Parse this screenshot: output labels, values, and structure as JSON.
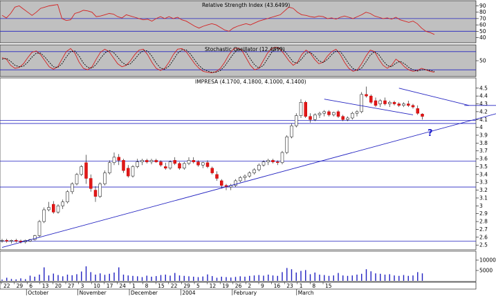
{
  "chart_data": [
    {
      "type": "line",
      "title": "Relative Strength Index (43.6499)",
      "y_ticks": [
        40,
        50,
        60,
        70,
        80,
        90
      ],
      "ylim": [
        33,
        97
      ],
      "reference_lines": [
        70,
        50
      ],
      "series": [
        {
          "color": "#d42020",
          "values": [
            75,
            71,
            78,
            88,
            90,
            85,
            80,
            75,
            80,
            86,
            88,
            90,
            91,
            92,
            70,
            67,
            68,
            78,
            80,
            83,
            82,
            80,
            73,
            74,
            76,
            78,
            77,
            73,
            71,
            76,
            74,
            72,
            70,
            68,
            69,
            66,
            70,
            73,
            70,
            73,
            70,
            72,
            68,
            66,
            62,
            58,
            55,
            58,
            60,
            62,
            60,
            56,
            52,
            50,
            55,
            58,
            60,
            62,
            60,
            63,
            66,
            68,
            70,
            72,
            74,
            76,
            82,
            88,
            86,
            80,
            76,
            75,
            73,
            72,
            74,
            73,
            70,
            71,
            69,
            72,
            74,
            72,
            70,
            73,
            76,
            80,
            78,
            74,
            72,
            70,
            71,
            69,
            72,
            68,
            66,
            64,
            66,
            62,
            55,
            50,
            48,
            45
          ]
        }
      ]
    },
    {
      "type": "line",
      "title": "Stochastic Oscillator (12.4899)",
      "y_ticks": [
        50
      ],
      "ylim": [
        0,
        100
      ],
      "reference_lines": [
        80,
        20
      ],
      "series": [
        {
          "color": "#d42020",
          "values": [
            60,
            55,
            35,
            25,
            28,
            40,
            60,
            78,
            82,
            70,
            50,
            30,
            22,
            30,
            55,
            80,
            90,
            75,
            45,
            25,
            20,
            30,
            55,
            78,
            88,
            80,
            60,
            40,
            30,
            35,
            50,
            70,
            85,
            88,
            70,
            45,
            25,
            18,
            25,
            45,
            70,
            88,
            90,
            80,
            60,
            40,
            25,
            15,
            12,
            10,
            14,
            25,
            45,
            70,
            88,
            92,
            85,
            60,
            35,
            20,
            25,
            50,
            75,
            90,
            95,
            88,
            70,
            50,
            35,
            45,
            70,
            85,
            75,
            55,
            40,
            45,
            65,
            80,
            88,
            70,
            45,
            25,
            15,
            20,
            40,
            65,
            85,
            80,
            55,
            35,
            25,
            35,
            55,
            45,
            30,
            20,
            15,
            18,
            25,
            20,
            15,
            12
          ]
        },
        {
          "color": "#000000",
          "values": [
            55,
            58,
            48,
            35,
            30,
            32,
            45,
            62,
            75,
            75,
            62,
            45,
            30,
            28,
            40,
            62,
            80,
            82,
            65,
            42,
            28,
            26,
            38,
            58,
            75,
            84,
            78,
            62,
            45,
            36,
            40,
            55,
            72,
            84,
            82,
            65,
            42,
            26,
            22,
            32,
            52,
            74,
            86,
            86,
            72,
            52,
            34,
            22,
            16,
            12,
            12,
            18,
            32,
            52,
            72,
            86,
            88,
            78,
            56,
            36,
            26,
            34,
            56,
            78,
            90,
            92,
            82,
            64,
            46,
            42,
            56,
            74,
            78,
            66,
            50,
            44,
            54,
            70,
            82,
            80,
            62,
            40,
            24,
            18,
            26,
            46,
            68,
            80,
            70,
            50,
            34,
            30,
            42,
            48,
            40,
            28,
            20,
            16,
            20,
            21,
            18,
            15
          ]
        }
      ]
    },
    {
      "type": "candlestick",
      "title": "IMPRESA (4.1700, 4.1800, 4.1000, 4.1400)",
      "ylim": [
        2.44,
        4.63
      ],
      "y_ticks": [
        2.5,
        2.6,
        2.7,
        2.8,
        2.9,
        3.0,
        3.1,
        3.2,
        3.3,
        3.4,
        3.5,
        3.6,
        3.7,
        3.8,
        3.9,
        4.0,
        4.1,
        4.2,
        4.3,
        4.4,
        4.5
      ],
      "x_tick_labels": [
        "22",
        "29",
        "6",
        "13",
        "20",
        "27",
        "3",
        "10",
        "17",
        "24",
        "1",
        "8",
        "15",
        "22",
        "29",
        "5",
        "12",
        "19",
        "26",
        "2",
        "9",
        "16",
        "23",
        "1",
        "8",
        "15"
      ],
      "month_labels": [
        "October",
        "November",
        "December",
        "2004",
        "February",
        "March"
      ],
      "annotation": "?",
      "horizontal_levels": [
        4.09,
        4.05,
        3.57,
        3.24,
        2.55
      ],
      "trend_lines": [
        {
          "from": [
            0,
            2.47
          ],
          "to": [
            108,
            4.21
          ],
          "color": "#2020c0"
        },
        {
          "from": [
            69,
            4.36
          ],
          "to": [
            88,
            4.16
          ],
          "color": "#2020c0"
        },
        {
          "from": [
            85,
            4.5
          ],
          "to": [
            100,
            4.28
          ],
          "color": "#2020c0"
        },
        {
          "from": [
            99,
            4.28
          ],
          "to": [
            106,
            4.28
          ],
          "color": "#2020c0"
        }
      ],
      "candles": [
        [
          2.56,
          2.58,
          2.53,
          2.56
        ],
        [
          2.56,
          2.58,
          2.53,
          2.55
        ],
        [
          2.55,
          2.57,
          2.52,
          2.56
        ],
        [
          2.56,
          2.58,
          2.53,
          2.55
        ],
        [
          2.55,
          2.57,
          2.52,
          2.54
        ],
        [
          2.54,
          2.57,
          2.52,
          2.56
        ],
        [
          2.55,
          2.58,
          2.54,
          2.57
        ],
        [
          2.57,
          2.63,
          2.56,
          2.62
        ],
        [
          2.62,
          2.82,
          2.6,
          2.8
        ],
        [
          2.8,
          2.98,
          2.78,
          2.95
        ],
        [
          2.95,
          3.05,
          2.93,
          2.98
        ],
        [
          3.02,
          3.06,
          2.9,
          2.92
        ],
        [
          2.92,
          3.02,
          2.9,
          3.0
        ],
        [
          3.0,
          3.08,
          2.96,
          3.05
        ],
        [
          3.05,
          3.2,
          3.03,
          3.18
        ],
        [
          3.18,
          3.3,
          3.15,
          3.28
        ],
        [
          3.28,
          3.42,
          3.26,
          3.4
        ],
        [
          3.4,
          3.52,
          3.38,
          3.5
        ],
        [
          3.55,
          3.65,
          3.28,
          3.35
        ],
        [
          3.35,
          3.4,
          3.18,
          3.22
        ],
        [
          3.2,
          3.25,
          3.05,
          3.12
        ],
        [
          3.12,
          3.3,
          3.1,
          3.28
        ],
        [
          3.28,
          3.45,
          3.26,
          3.42
        ],
        [
          3.42,
          3.58,
          3.4,
          3.55
        ],
        [
          3.55,
          3.68,
          3.52,
          3.62
        ],
        [
          3.62,
          3.66,
          3.52,
          3.58
        ],
        [
          3.58,
          3.6,
          3.42,
          3.45
        ],
        [
          3.48,
          3.52,
          3.36,
          3.38
        ],
        [
          3.38,
          3.52,
          3.36,
          3.5
        ],
        [
          3.5,
          3.6,
          3.48,
          3.56
        ],
        [
          3.56,
          3.6,
          3.52,
          3.58
        ],
        [
          3.58,
          3.6,
          3.54,
          3.56
        ],
        [
          3.56,
          3.6,
          3.53,
          3.58
        ],
        [
          3.58,
          3.6,
          3.55,
          3.56
        ],
        [
          3.56,
          3.58,
          3.5,
          3.52
        ],
        [
          3.5,
          3.55,
          3.46,
          3.48
        ],
        [
          3.48,
          3.58,
          3.46,
          3.56
        ],
        [
          3.58,
          3.62,
          3.52,
          3.54
        ],
        [
          3.54,
          3.56,
          3.46,
          3.48
        ],
        [
          3.48,
          3.56,
          3.46,
          3.54
        ],
        [
          3.54,
          3.62,
          3.52,
          3.58
        ],
        [
          3.58,
          3.62,
          3.54,
          3.56
        ],
        [
          3.56,
          3.58,
          3.5,
          3.52
        ],
        [
          3.52,
          3.56,
          3.48,
          3.55
        ],
        [
          3.55,
          3.58,
          3.48,
          3.5
        ],
        [
          3.48,
          3.5,
          3.4,
          3.42
        ],
        [
          3.4,
          3.44,
          3.32,
          3.35
        ],
        [
          3.32,
          3.34,
          3.22,
          3.26
        ],
        [
          3.26,
          3.28,
          3.2,
          3.24
        ],
        [
          3.24,
          3.28,
          3.2,
          3.26
        ],
        [
          3.26,
          3.34,
          3.24,
          3.32
        ],
        [
          3.32,
          3.38,
          3.3,
          3.36
        ],
        [
          3.36,
          3.4,
          3.32,
          3.38
        ],
        [
          3.38,
          3.44,
          3.36,
          3.42
        ],
        [
          3.42,
          3.48,
          3.4,
          3.46
        ],
        [
          3.46,
          3.54,
          3.44,
          3.52
        ],
        [
          3.52,
          3.58,
          3.5,
          3.56
        ],
        [
          3.56,
          3.6,
          3.52,
          3.58
        ],
        [
          3.58,
          3.6,
          3.54,
          3.56
        ],
        [
          3.56,
          3.58,
          3.52,
          3.55
        ],
        [
          3.55,
          3.7,
          3.53,
          3.68
        ],
        [
          3.68,
          3.9,
          3.66,
          3.88
        ],
        [
          3.88,
          4.05,
          3.86,
          4.02
        ],
        [
          4.02,
          4.18,
          4.0,
          4.15
        ],
        [
          4.15,
          4.36,
          4.12,
          4.32
        ],
        [
          4.32,
          4.34,
          4.12,
          4.14
        ],
        [
          4.14,
          4.18,
          4.06,
          4.1
        ],
        [
          4.1,
          4.18,
          4.08,
          4.16
        ],
        [
          4.16,
          4.2,
          4.12,
          4.18
        ],
        [
          4.18,
          4.22,
          4.14,
          4.2
        ],
        [
          4.2,
          4.22,
          4.14,
          4.16
        ],
        [
          4.16,
          4.2,
          4.14,
          4.19
        ],
        [
          4.2,
          4.22,
          4.12,
          4.14
        ],
        [
          4.14,
          4.16,
          4.08,
          4.1
        ],
        [
          4.1,
          4.14,
          4.08,
          4.12
        ],
        [
          4.12,
          4.2,
          4.1,
          4.18
        ],
        [
          4.18,
          4.22,
          4.14,
          4.2
        ],
        [
          4.2,
          4.45,
          4.18,
          4.42
        ],
        [
          4.42,
          4.52,
          4.38,
          4.4
        ],
        [
          4.4,
          4.42,
          4.3,
          4.32
        ],
        [
          4.34,
          4.38,
          4.26,
          4.28
        ],
        [
          4.3,
          4.36,
          4.26,
          4.34
        ],
        [
          4.34,
          4.38,
          4.28,
          4.3
        ],
        [
          4.3,
          4.34,
          4.26,
          4.32
        ],
        [
          4.32,
          4.34,
          4.28,
          4.3
        ],
        [
          4.3,
          4.32,
          4.26,
          4.28
        ],
        [
          4.28,
          4.32,
          4.26,
          4.3
        ],
        [
          4.3,
          4.34,
          4.26,
          4.28
        ],
        [
          4.28,
          4.3,
          4.24,
          4.26
        ],
        [
          4.24,
          4.28,
          4.16,
          4.18
        ],
        [
          4.17,
          4.18,
          4.1,
          4.14
        ]
      ]
    },
    {
      "type": "bar",
      "title": "",
      "y_ticks": [
        5000,
        10000
      ],
      "ylim": [
        0,
        14000
      ],
      "values": [
        600,
        1500,
        900,
        700,
        1200,
        800,
        2500,
        2000,
        3000,
        6500,
        2600,
        3500,
        2800,
        2200,
        3000,
        2700,
        3200,
        4500,
        7000,
        4200,
        3000,
        3600,
        2900,
        3400,
        4000,
        6500,
        3000,
        2600,
        2400,
        2200,
        1800,
        2500,
        2000,
        2300,
        2800,
        3000,
        2500,
        3800,
        2600,
        2400,
        2200,
        2000,
        1800,
        2100,
        3100,
        2300,
        1500,
        2000,
        1800,
        1600,
        1900,
        2200,
        2000,
        2400,
        2600,
        2800,
        2500,
        3000,
        2600,
        2400,
        4200,
        6200,
        5600,
        4000,
        4800,
        5200,
        3200,
        4000,
        3000,
        2800,
        2400,
        2600,
        3800,
        2600,
        2400,
        2600,
        3000,
        3400,
        5600,
        4600,
        3600,
        3400,
        3000,
        3200,
        2600,
        2400,
        2800,
        2400,
        2600,
        4200,
        3600
      ]
    }
  ]
}
